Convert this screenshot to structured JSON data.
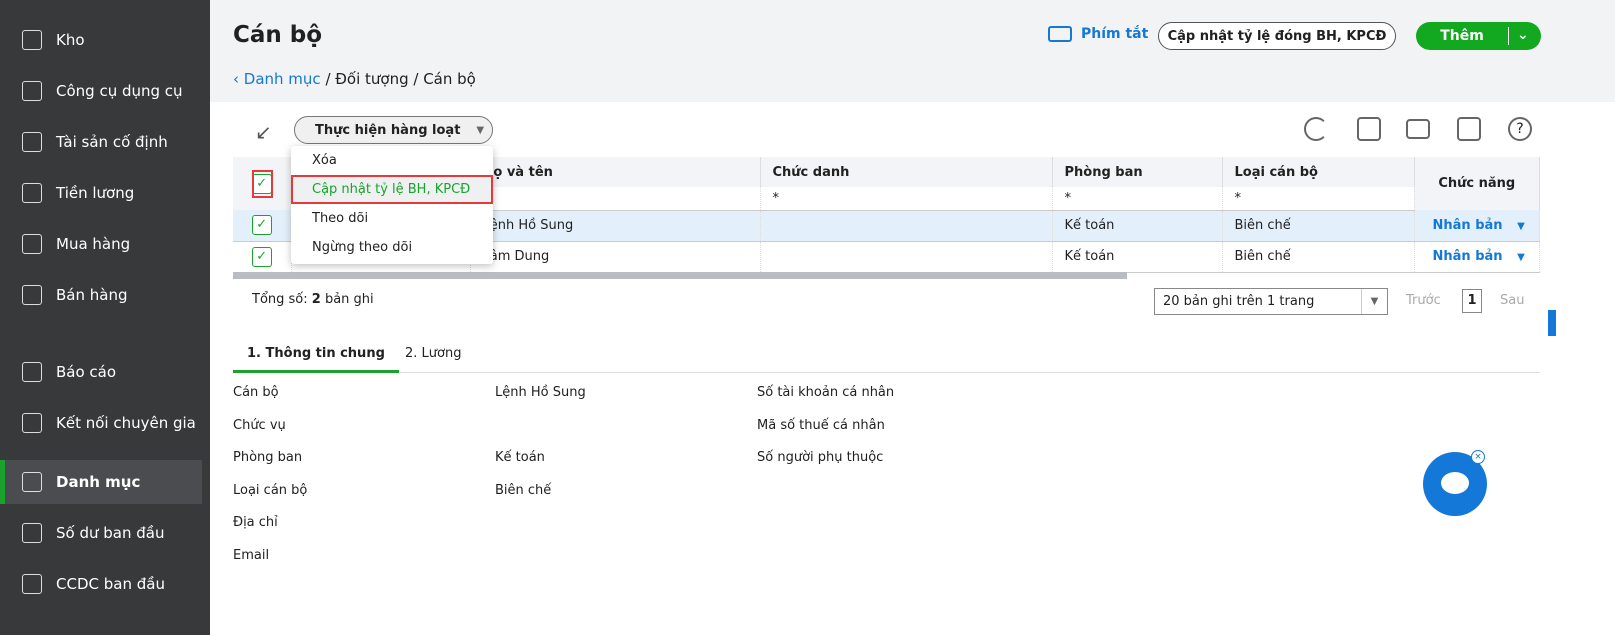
{
  "sidebar": {
    "items": [
      {
        "label": "Kho",
        "icon": "warehouse-icon"
      },
      {
        "label": "Công cụ dụng cụ",
        "icon": "tools-icon"
      },
      {
        "label": "Tài sản cố định",
        "icon": "car-icon"
      },
      {
        "label": "Tiền lương",
        "icon": "salary-icon"
      },
      {
        "label": "Mua hàng",
        "icon": "bag-icon"
      },
      {
        "label": "Bán hàng",
        "icon": "cart-icon"
      },
      {
        "label": "Báo cáo",
        "icon": "chart-icon"
      },
      {
        "label": "Kết nối chuyên gia",
        "icon": "expert-icon"
      },
      {
        "label": "Danh mục",
        "icon": "list-icon",
        "active": true
      },
      {
        "label": "Số dư ban đầu",
        "icon": "balance-icon"
      },
      {
        "label": "CCDC ban đầu",
        "icon": "tools-doc-icon"
      }
    ]
  },
  "header": {
    "title": "Cán bộ",
    "breadcrumb": [
      "Danh mục",
      "/ Đối tượng / Cán bộ"
    ],
    "shortcut": "Phím tắt",
    "update_btn": "Cập nhật tỷ lệ đóng BH, KPCĐ",
    "add_btn": "Thêm"
  },
  "toolbar": {
    "bulk": "Thực hiện hàng loạt",
    "menu": [
      "Xóa",
      "Cập nhật tỷ lệ BH, KPCĐ",
      "Theo dõi",
      "Ngừng theo dõi"
    ]
  },
  "table": {
    "columns": [
      "Họ và tên",
      "Chức danh",
      "Phòng ban",
      "Loại cán bộ",
      "Chức năng"
    ],
    "filter": "*",
    "rows": [
      {
        "name": "Lệnh Hồ Sung",
        "title": "",
        "dept": "Kế toán",
        "type": "Biên chế",
        "action": "Nhân bản"
      },
      {
        "name": "Lâm Dung",
        "title": "",
        "dept": "Kế toán",
        "type": "Biên chế",
        "action": "Nhân bản"
      }
    ]
  },
  "footer": {
    "total_label": "Tổng số:",
    "total": "2",
    "total_unit": "bản ghi",
    "page_size": "20 bản ghi trên 1 trang",
    "prev": "Trước",
    "page": "1",
    "next": "Sau"
  },
  "detail": {
    "tabs": [
      "1. Thông tin chung",
      "2. Lương"
    ],
    "labels": [
      "Cán bộ",
      "Chức vụ",
      "Phòng ban",
      "Loại cán bộ",
      "Địa chỉ",
      "Email"
    ],
    "values": [
      "Lệnh Hồ Sung",
      "",
      "Kế toán",
      "Biên chế"
    ],
    "labels2": [
      "Số tài khoản cá nhân",
      "Mã số thuế cá nhân",
      "Số người phụ thuộc"
    ]
  },
  "colors": {
    "accent": "#12a820",
    "link": "#1479d4",
    "highlight": "#e63a3a"
  }
}
